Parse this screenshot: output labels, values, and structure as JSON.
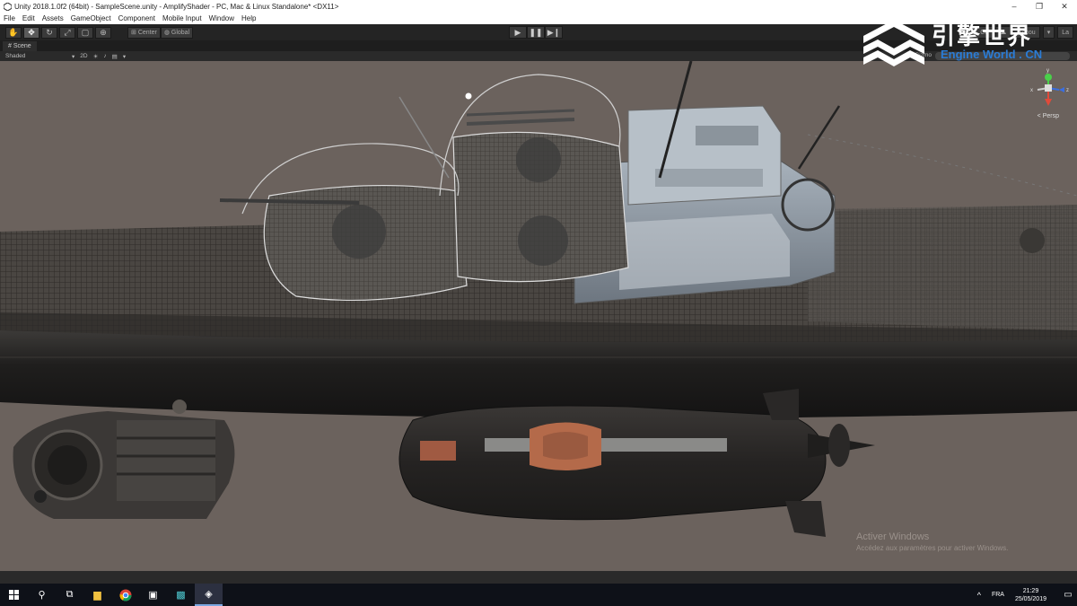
{
  "window": {
    "title": "Unity 2018.1.0f2 (64bit) - SampleScene.unity - AmplifyShader - PC, Mac & Linux Standalone* <DX11>",
    "minimize_glyph": "–",
    "maximize_glyph": "❐",
    "close_glyph": "✕"
  },
  "menu": [
    "File",
    "Edit",
    "Assets",
    "GameObject",
    "Component",
    "Mobile Input",
    "Window",
    "Help"
  ],
  "toolbar": {
    "pivot_center": "Center",
    "pivot_global": "Global",
    "collab_label": "Co",
    "account_label": "Accou",
    "layout_label": "La"
  },
  "scene": {
    "tab_label": "Scene",
    "shading_mode": "Shaded",
    "mode_2d": "2D",
    "gizmos_label": "Gizmo",
    "persp_label": "< Persp"
  },
  "activation": {
    "line1": "Activer Windows",
    "line2": "Accédez aux paramètres pour activer Windows."
  },
  "watermark": {
    "cn": "引擎世界",
    "en": "Engine World . CN"
  },
  "taskbar": {
    "language": "FRA",
    "time": "21:29",
    "date": "25/05/2019"
  },
  "colors": {
    "viewport_bg": "#6b625d",
    "unity_dark": "#242424",
    "watermark_blue": "#2a7cd6"
  }
}
